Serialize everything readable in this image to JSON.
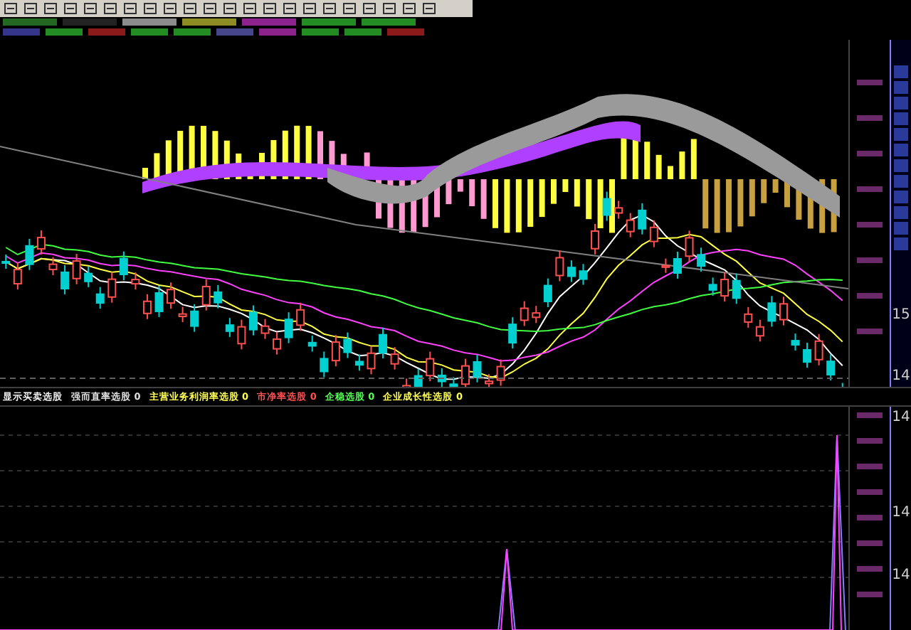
{
  "indicator_bar": {
    "items": [
      {
        "label": "显示买卖选股",
        "color": "#f0f0f0"
      },
      {
        "label": "强而直率选股",
        "value": "0",
        "color": "#e0e0e0"
      },
      {
        "label": "主营业务利润率选股",
        "value": "0",
        "color": "#ffff54"
      },
      {
        "label": "市净率选股",
        "value": "0",
        "color": "#ff5050"
      },
      {
        "label": "企稳选股",
        "value": "0",
        "color": "#54ff54"
      },
      {
        "label": "企业成长性选股",
        "value": "0",
        "color": "#ffff54"
      }
    ]
  },
  "main_chart": {
    "axis_labels": [
      "15",
      "14"
    ]
  },
  "lower_chart": {
    "axis_labels": [
      "14",
      "14",
      "14"
    ]
  }
}
